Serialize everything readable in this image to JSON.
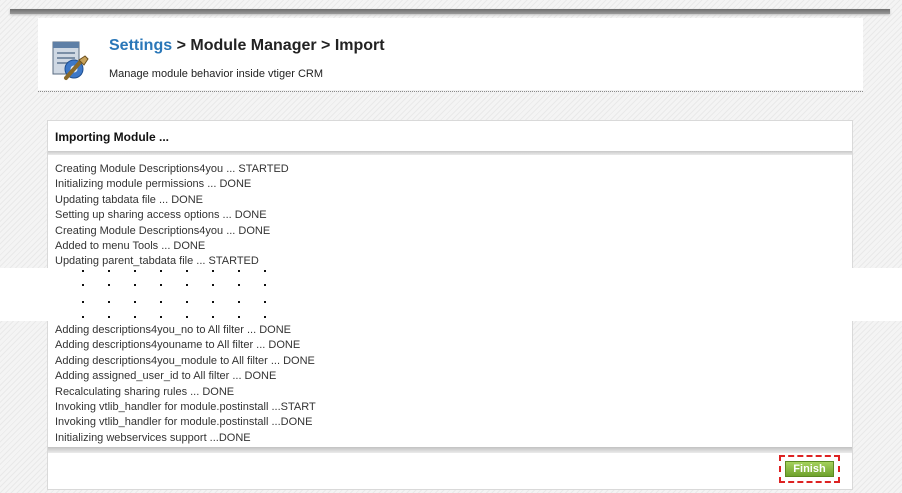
{
  "header": {
    "breadcrumb": {
      "settings": "Settings",
      "sep1": " > ",
      "module_manager": "Module Manager",
      "sep2": " > ",
      "current": "Import"
    },
    "subtitle": "Manage module behavior inside vtiger CRM",
    "icon": "settings-tools-icon"
  },
  "panel": {
    "title": "Importing Module ...",
    "log_lines_top": [
      "Creating Module Descriptions4you ... STARTED",
      "Initializing module permissions ... DONE",
      "Updating tabdata file ... DONE",
      "Setting up sharing access options ... DONE",
      "Creating Module Descriptions4you ... DONE",
      "Added to menu Tools ... DONE",
      "Updating parent_tabdata file ... STARTED"
    ],
    "log_lines_bottom": [
      "Adding descriptions4you_no to All filter ... DONE",
      "Adding descriptions4youname to All filter ... DONE",
      "Adding descriptions4you_module to All filter ... DONE",
      "Adding assigned_user_id to All filter ... DONE",
      "Recalculating sharing rules ... DONE",
      "Invoking vtlib_handler for module.postinstall ...START",
      "Invoking vtlib_handler for module.postinstall ...DONE",
      "Initializing webservices support ...DONE"
    ],
    "finish_label": "Finish"
  },
  "colors": {
    "link": "#2a77b8",
    "finish_button": "#8bbd43",
    "highlight_frame": "#dd2222"
  }
}
